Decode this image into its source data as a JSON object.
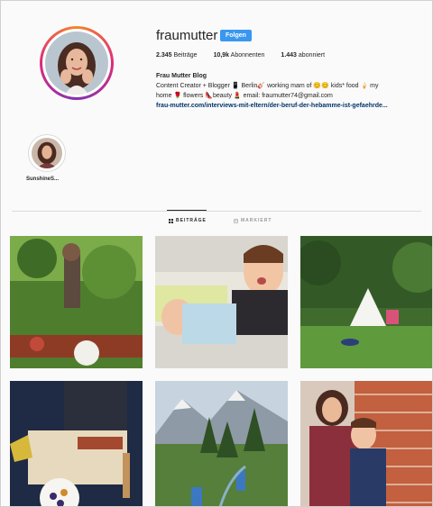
{
  "profile": {
    "username": "fraumutter",
    "follow_label": "Folgen",
    "stats": {
      "posts_count": "2.345",
      "posts_label": "Beiträge",
      "followers_count": "10,9k",
      "followers_label": "Abonnenten",
      "following_count": "1.443",
      "following_label": "abonniert"
    },
    "bio": {
      "name": "Frau Mutter Blog",
      "line1": "Content Creator + Blogger 📱 Berlin🎸 working mam of 😊😊 kids* food 🍦 my",
      "line2": "home 🌹 flowers 👠beauty 💄 email: fraumutter74@gmail.com",
      "link": "frau-mutter.com/interviews-mit-eltern/der-beruf-der-hebamme-ist-gefaehrde..."
    }
  },
  "highlights": [
    {
      "label": "SunshineS..."
    }
  ],
  "tabs": [
    {
      "label": "BEITRÄGE",
      "icon": "grid-icon",
      "active": true
    },
    {
      "label": "MARKIERT",
      "icon": "tag-icon",
      "active": false
    }
  ],
  "posts": [
    {
      "icon": "photo-garden-mother-child"
    },
    {
      "icon": "photo-kids-lying-bed"
    },
    {
      "icon": "photo-tent-in-garden"
    },
    {
      "icon": "photo-baking-cake"
    },
    {
      "icon": "photo-mountain-hiking"
    },
    {
      "icon": "photo-mother-son-brick-wall"
    }
  ],
  "colors": {
    "accent": "#3897f0",
    "link": "#003569",
    "text": "#262626",
    "muted": "#999999",
    "border": "#dbdbdb"
  }
}
